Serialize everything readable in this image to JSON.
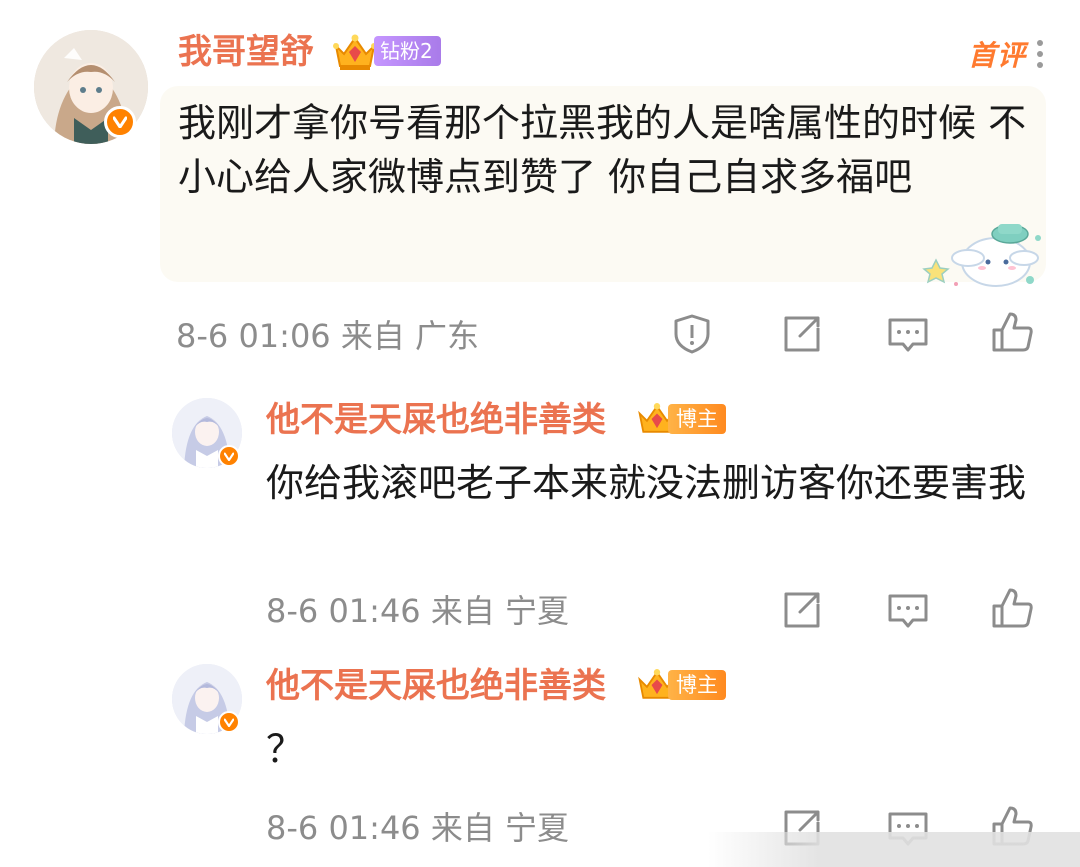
{
  "main_comment": {
    "username": "我哥望舒",
    "fan_badge": "钻粉2",
    "tag": "首评",
    "text": "我刚才拿你号看那个拉黑我的人是啥属性的时候 不小心给人家微博点到赞了 你自己自求多福吧",
    "meta": "8-6 01:06 来自 广东",
    "icons": [
      "report-icon",
      "repost-icon",
      "comment-icon",
      "like-icon"
    ]
  },
  "replies": [
    {
      "username": "他不是天屎也绝非善类",
      "badge": "博主",
      "text": "你给我滚吧老子本来就没法删访客你还要害我",
      "meta": "8-6 01:46 来自 宁夏",
      "icons": [
        "repost-icon",
        "comment-icon",
        "like-icon"
      ]
    },
    {
      "username": "他不是天屎也绝非善类",
      "badge": "博主",
      "text": "？",
      "meta": "8-6 01:46 来自 宁夏",
      "icons": [
        "repost-icon",
        "comment-icon",
        "like-icon"
      ]
    }
  ],
  "colors": {
    "username": "#eb7350",
    "verified": "#ff8200",
    "fan_badge": "#b487f4",
    "owner_badge": "#ff9a2e",
    "meta": "#8c8c8c",
    "text": "#1a1a1a",
    "card_bg": "#fcfaf3"
  }
}
